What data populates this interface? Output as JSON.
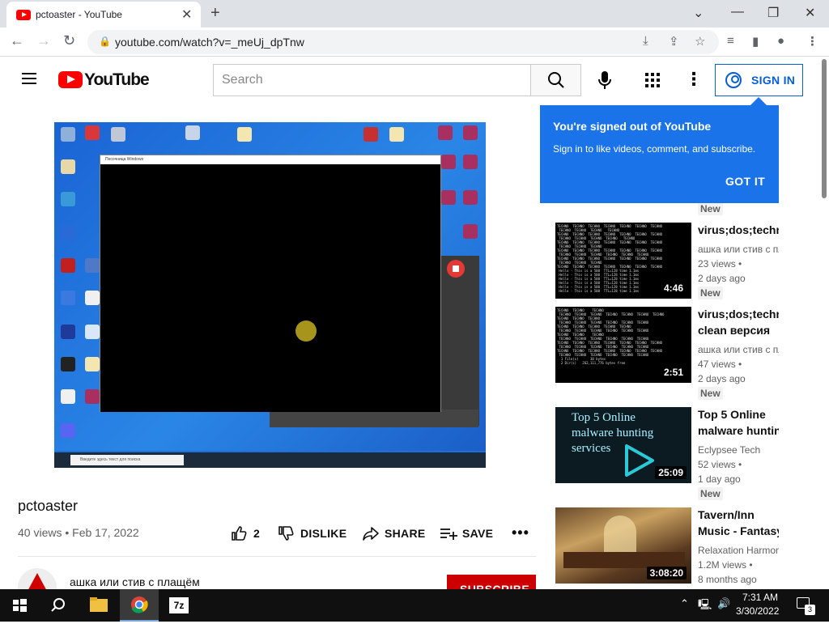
{
  "browser": {
    "tab_title": "pctoaster - YouTube",
    "url": "youtube.com/watch?v=_meUj_dpTnw"
  },
  "header": {
    "logo_text": "YouTube",
    "search_placeholder": "Search",
    "sign_in_label": "SIGN IN"
  },
  "tooltip": {
    "title": "You're signed out of YouTube",
    "body": "Sign in to like videos, comment, and subscribe.",
    "button": "GOT IT"
  },
  "video": {
    "title": "pctoaster",
    "meta": "40 views • Feb 17, 2022",
    "like_count": "2",
    "dislike_label": "DISLIKE",
    "share_label": "SHARE",
    "save_label": "SAVE",
    "channel_name": "ашка или стив с плащём",
    "subscribe_label": "SUBSCRIBE",
    "inner_window_title": "Песочница Windows",
    "inner_search_text": "Введите здесь текст для поиска"
  },
  "recommendations": [
    {
      "title": "virus;dos;technology",
      "title2": "",
      "channel": "ашка или стив с плащём",
      "views": "23 views •",
      "date": "2 days ago",
      "badge": "New",
      "duration": "4:46"
    },
    {
      "title": "virus;dos;technology",
      "title2": "clean версия",
      "channel": "ашка или стив с плащём",
      "views": "47 views •",
      "date": "2 days ago",
      "badge": "New",
      "duration": "2:51"
    },
    {
      "title": "Top 5 Online",
      "title2": "malware hunting services",
      "channel": "Eclypsee Tech",
      "views": "52 views •",
      "date": "1 day ago",
      "badge": "New",
      "duration": "25:09",
      "thumb_text": "Top 5 Online malware hunting services"
    },
    {
      "title": "Tavern/Inn",
      "title2": "Music - Fantasy",
      "channel": "Relaxation Harmony",
      "views": "1.2M views •",
      "date": "8 months ago",
      "badge": "",
      "duration": "3:08:20"
    }
  ],
  "top_badge": "New",
  "taskbar": {
    "time": "7:31 AM",
    "date": "3/30/2022",
    "notifications": "3",
    "app_7z": "7z"
  },
  "colors": {
    "yt_red": "#ff0000",
    "link_blue": "#065fd4",
    "tooltip_blue": "#1a73e8",
    "subscribe_red": "#cc0000"
  }
}
